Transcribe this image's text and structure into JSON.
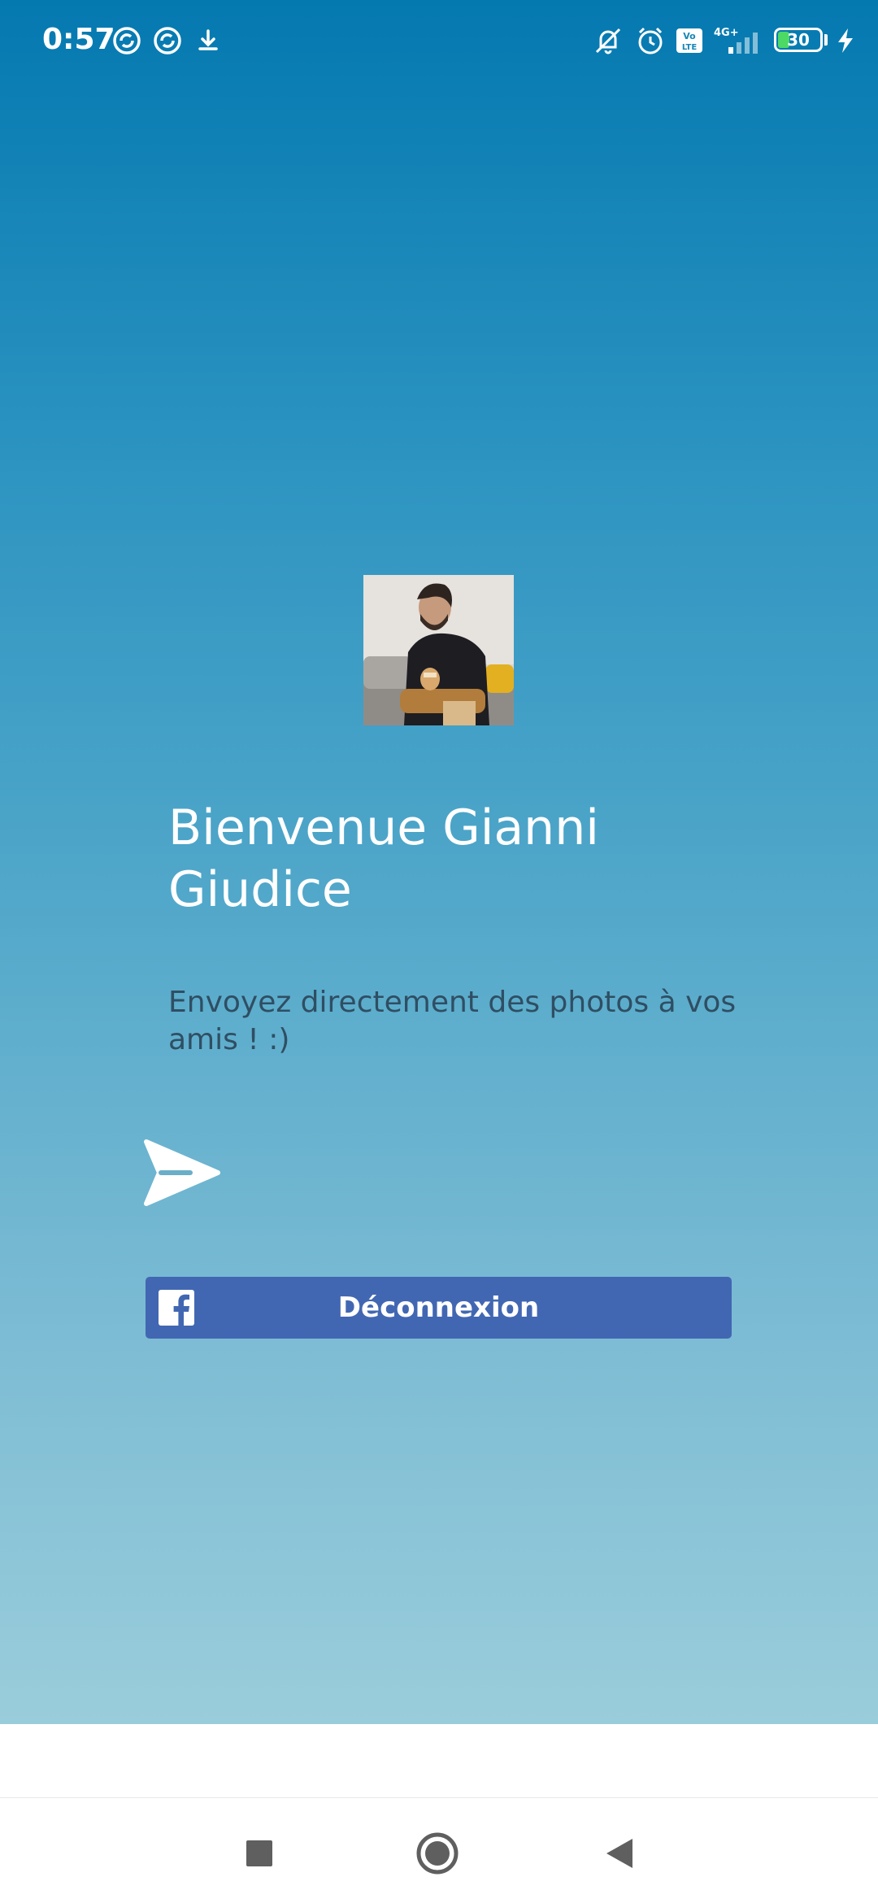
{
  "status_bar": {
    "time": "0:57",
    "network": "4G+",
    "volte": "Vo LTE",
    "battery_level": "30",
    "icons": [
      "sync-icon",
      "sync-icon",
      "download-icon",
      "vibrate-off-icon",
      "alarm-icon",
      "volte-icon",
      "signal-icon",
      "battery-icon",
      "charging-icon"
    ]
  },
  "profile": {
    "avatar_icon": "avatar-photo"
  },
  "welcome": {
    "title": "Bienvenue Gianni Giudice",
    "subtitle": "Envoyez directement des photos à vos amis ! :)"
  },
  "actions": {
    "send_icon": "send-icon",
    "logout_label": "Déconnexion",
    "logout_icon": "facebook-icon"
  },
  "colors": {
    "facebook_blue": "#4267b2",
    "gradient_top": "#0479b0",
    "gradient_bottom": "#9acddb"
  },
  "nav": {
    "icons": [
      "recents-square-icon",
      "home-circle-icon",
      "back-triangle-icon"
    ]
  }
}
